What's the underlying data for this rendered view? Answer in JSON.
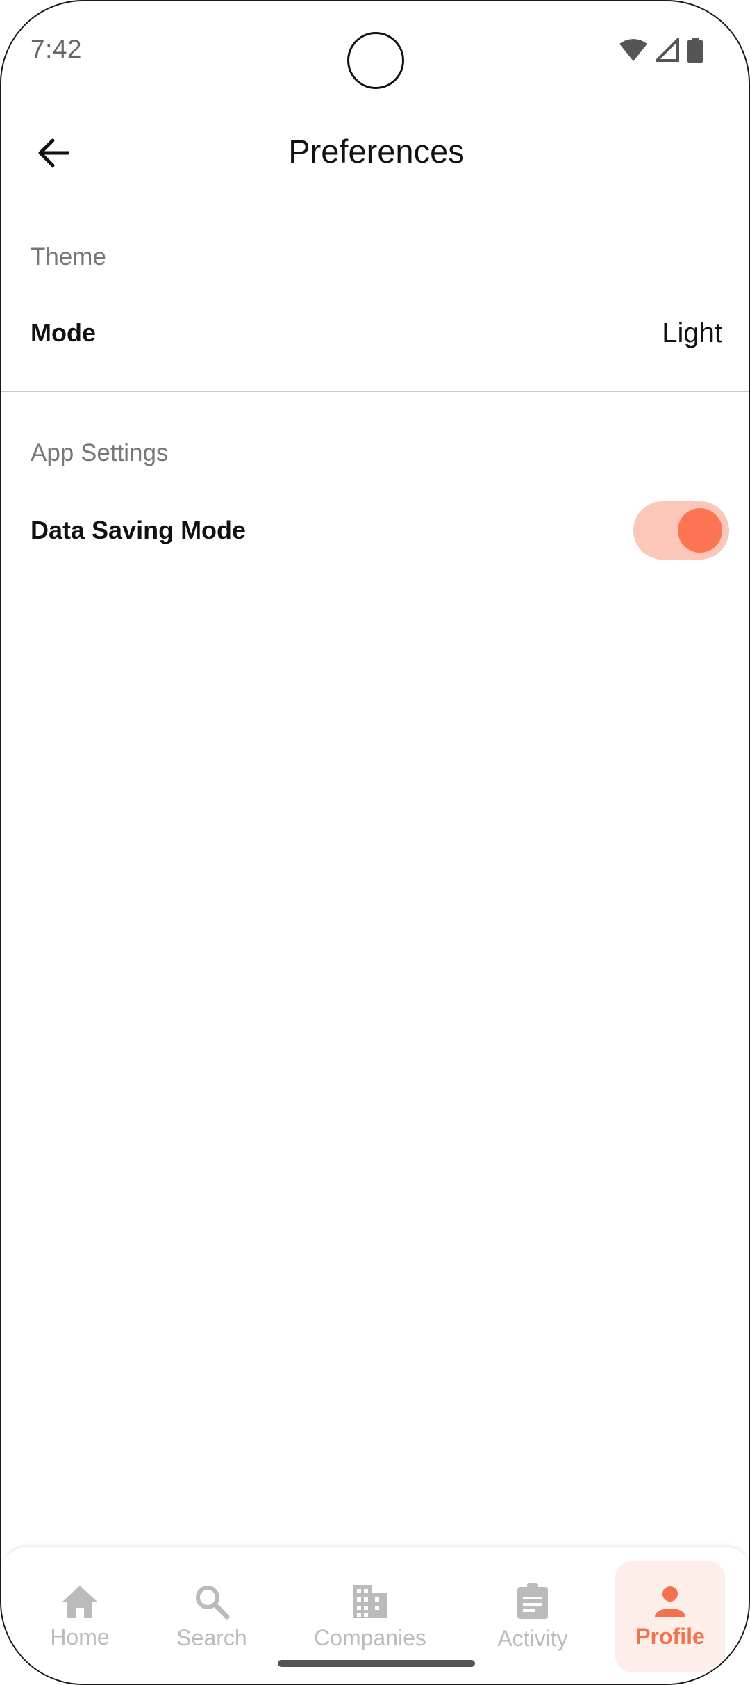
{
  "status_bar": {
    "time": "7:42",
    "icons": [
      "wifi-icon",
      "signal-icon",
      "battery-icon"
    ]
  },
  "app_bar": {
    "title": "Preferences",
    "back_icon": "arrow-left-icon"
  },
  "sections": {
    "theme": {
      "header": "Theme",
      "mode_label": "Mode",
      "mode_value": "Light"
    },
    "app_settings": {
      "header": "App Settings",
      "data_saving_label": "Data Saving Mode",
      "data_saving_enabled": true
    }
  },
  "bottom_nav": {
    "items": [
      {
        "label": "Home",
        "icon": "home-icon",
        "active": false
      },
      {
        "label": "Search",
        "icon": "search-icon",
        "active": false
      },
      {
        "label": "Companies",
        "icon": "building-icon",
        "active": false
      },
      {
        "label": "Activity",
        "icon": "clipboard-icon",
        "active": false
      },
      {
        "label": "Profile",
        "icon": "person-icon",
        "active": true
      }
    ]
  },
  "colors": {
    "accent": "#fd7452",
    "accent_track": "#fcc7b8",
    "active_nav_bg": "#fdeeea",
    "inactive_nav": "#bbbbbb"
  }
}
